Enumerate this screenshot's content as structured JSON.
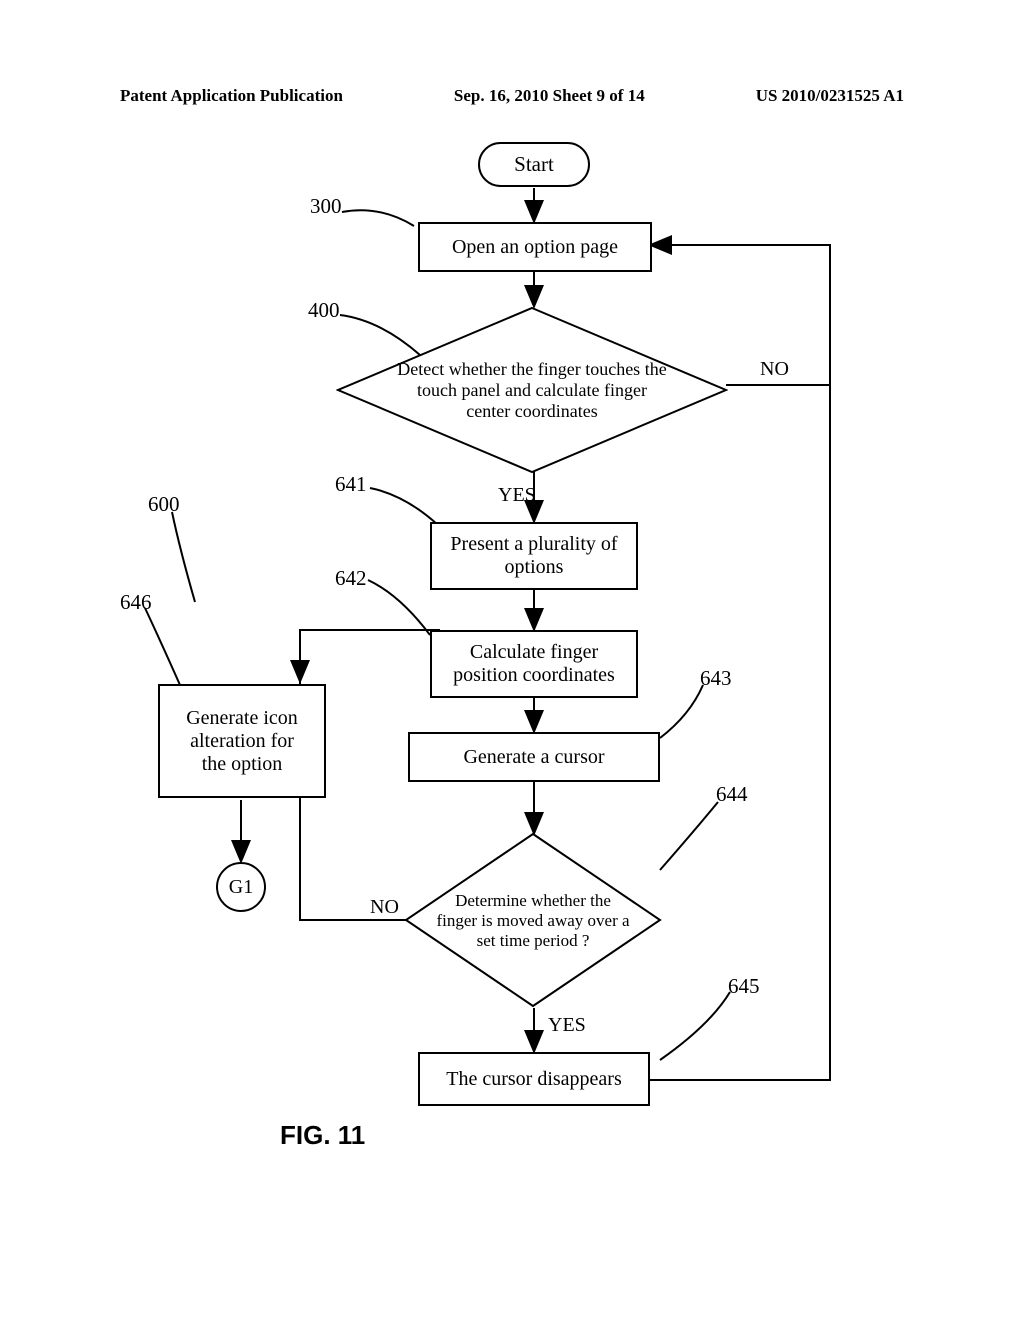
{
  "header": {
    "left": "Patent Application Publication",
    "center": "Sep. 16, 2010  Sheet 9 of 14",
    "right": "US 2010/0231525 A1"
  },
  "flowchart": {
    "start": "Start",
    "step300": {
      "ref": "300",
      "text": "Open an option page"
    },
    "step400": {
      "ref": "400",
      "text": "Detect whether the finger touches the touch panel and calculate finger center coordinates",
      "no": "NO",
      "yes": "YES"
    },
    "group600": "600",
    "step641": {
      "ref": "641",
      "text": "Present a plurality of options"
    },
    "step642": {
      "ref": "642",
      "text": "Calculate finger position coordinates"
    },
    "step643": {
      "ref": "643",
      "text": "Generate a cursor"
    },
    "step644": {
      "ref": "644",
      "text": "Determine whether the finger is moved away over a set time period ?",
      "no": "NO",
      "yes": "YES"
    },
    "step645": {
      "ref": "645",
      "text": "The cursor disappears"
    },
    "step646": {
      "ref": "646",
      "text": "Generate icon alteration for the option"
    },
    "g1": "G1"
  },
  "figure_label": "FIG. 11"
}
